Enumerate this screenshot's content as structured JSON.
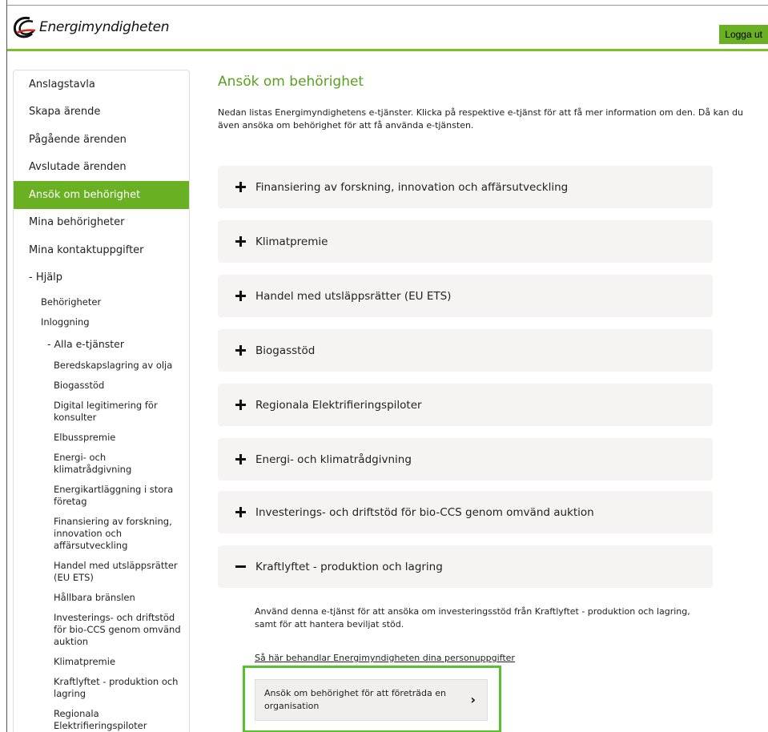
{
  "header": {
    "logo_text": "Energimyndigheten",
    "logout_label": "Logga ut",
    "accent": "#6ab023"
  },
  "sidebar": {
    "items": [
      {
        "label": "Anslagstavla"
      },
      {
        "label": "Skapa ärende"
      },
      {
        "label": "Pågående ärenden"
      },
      {
        "label": "Avslutade ärenden"
      },
      {
        "label": "Ansök om behörighet",
        "active": true
      },
      {
        "label": "Mina behörigheter"
      },
      {
        "label": "Mina kontaktuppgifter"
      },
      {
        "label": "- Hjälp"
      }
    ],
    "help_items": [
      "Behörigheter",
      "Inloggning"
    ],
    "all_services_label": "- Alla e-tjänster",
    "services": [
      "Beredskapslagring av olja",
      "Biogasstöd",
      "Digital legitimering för konsulter",
      "Elbusspremie",
      "Energi- och klimatrådgivning",
      "Energikartläggning i stora företag",
      "Finansiering av forskning, innovation och affärsutveckling",
      "Handel med utsläppsrätter (EU ETS)",
      "Hållbara bränslen",
      "Investerings- och driftstöd för bio-CCS genom omvänd auktion",
      "Klimatpremie",
      "Kraftlyftet - produktion och lagring",
      "Regionala Elektrifieringspiloter"
    ]
  },
  "main": {
    "title": "Ansök om behörighet",
    "intro": "Nedan listas Energimyndighetens e-tjänster. Klicka på respektive e-tjänst för att få mer information om den. Då kan du även ansöka om behörighet för att få använda e-tjänsten.",
    "accordion": [
      {
        "label": "Finansiering av forskning, innovation och affärsutveckling",
        "expanded": false
      },
      {
        "label": "Klimatpremie",
        "expanded": false
      },
      {
        "label": "Handel med utsläppsrätter (EU ETS)",
        "expanded": false
      },
      {
        "label": "Biogasstöd",
        "expanded": false
      },
      {
        "label": "Regionala Elektrifieringspiloter",
        "expanded": false
      },
      {
        "label": "Energi- och klimatrådgivning",
        "expanded": false
      },
      {
        "label": "Investerings- och driftstöd för bio-CCS genom omvänd auktion",
        "expanded": false
      },
      {
        "label": "Kraftlyftet - produktion och lagring",
        "expanded": true
      }
    ],
    "expanded_description": "Använd denna e-tjänst för att ansöka om investeringsstöd från Kraftlyftet - produktion och lagring, samt för att hantera beviljat stöd.",
    "privacy_link": "Så här behandlar Energimyndigheten dina personuppgifter",
    "apply_button": "Ansök om behörighet för att företräda en organisation",
    "apply_chevron": "›"
  }
}
